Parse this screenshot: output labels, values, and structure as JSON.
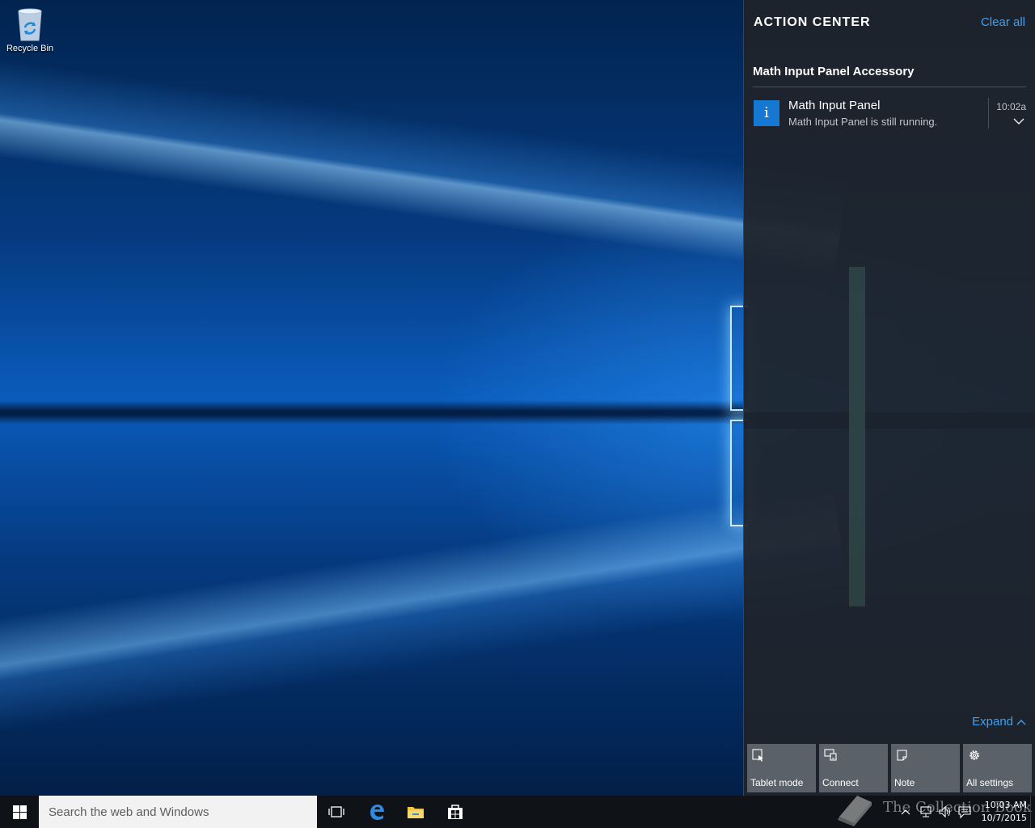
{
  "desktop": {
    "icons": [
      {
        "label": "Recycle Bin",
        "icon": "recycle-bin-icon"
      }
    ]
  },
  "action_center": {
    "title": "ACTION CENTER",
    "clear_all_label": "Clear all",
    "group": {
      "header": "Math Input Panel Accessory",
      "notification": {
        "icon": "info-icon",
        "icon_glyph": "i",
        "title": "Math Input Panel",
        "body": "Math Input Panel is still running.",
        "time": "10:02a"
      }
    },
    "expand_label": "Expand",
    "quick_actions": [
      {
        "label": "Tablet mode",
        "icon": "tablet-mode-icon"
      },
      {
        "label": "Connect",
        "icon": "connect-icon"
      },
      {
        "label": "Note",
        "icon": "note-icon"
      },
      {
        "label": "All settings",
        "icon": "settings-icon"
      }
    ],
    "accent_color": "#3fa0f0"
  },
  "taskbar": {
    "search_placeholder": "Search the web and Windows",
    "pinned": [
      {
        "name": "Task View",
        "icon": "task-view-icon"
      },
      {
        "name": "Microsoft Edge",
        "icon": "edge-icon"
      },
      {
        "name": "File Explorer",
        "icon": "file-explorer-icon"
      },
      {
        "name": "Store",
        "icon": "store-icon"
      }
    ],
    "tray": {
      "time": "10:03 AM",
      "date": "10/7/2015"
    },
    "watermark_text": "The Collection Book"
  }
}
